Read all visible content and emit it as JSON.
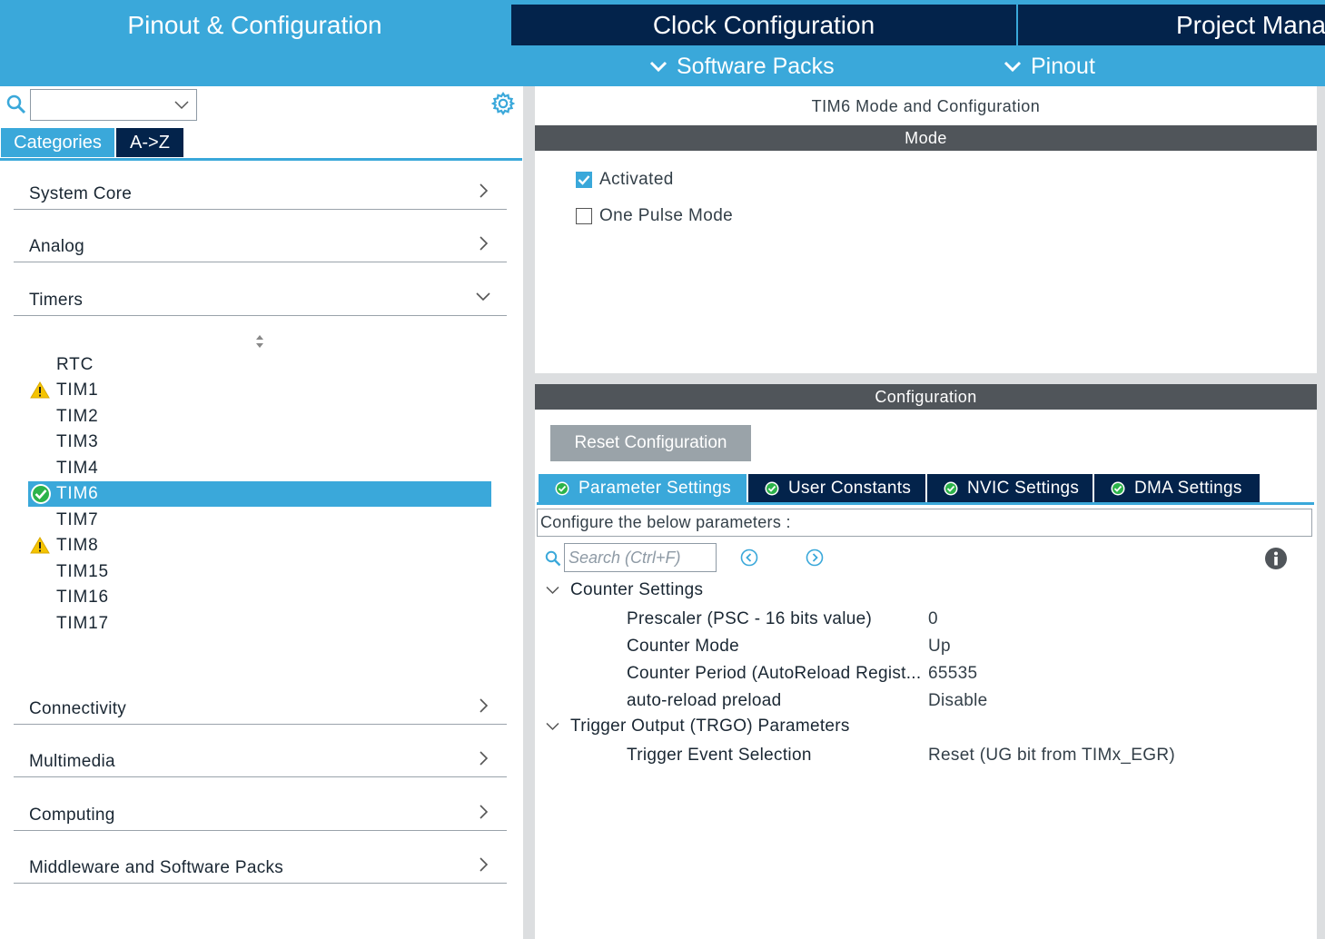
{
  "colors": {
    "accent": "#3aa8da",
    "navy": "#03234b",
    "bar": "#50555a",
    "warning": "#f5c400",
    "ok": "#2cb34a"
  },
  "top_tabs": {
    "pinout": "Pinout & Configuration",
    "clock": "Clock Configuration",
    "project": "Project Mana"
  },
  "sub_tabs": {
    "software_packs": "Software Packs",
    "pinout": "Pinout"
  },
  "left": {
    "combo_value": "",
    "tabs": {
      "categories": "Categories",
      "az": "A->Z"
    },
    "categories": [
      "System Core",
      "Analog",
      "Timers",
      "Connectivity",
      "Multimedia",
      "Computing",
      "Middleware and Software Packs"
    ],
    "timers": [
      {
        "name": "RTC",
        "status": "none"
      },
      {
        "name": "TIM1",
        "status": "warning"
      },
      {
        "name": "TIM2",
        "status": "none"
      },
      {
        "name": "TIM3",
        "status": "none"
      },
      {
        "name": "TIM4",
        "status": "none"
      },
      {
        "name": "TIM6",
        "status": "ok",
        "selected": true
      },
      {
        "name": "TIM7",
        "status": "none"
      },
      {
        "name": "TIM8",
        "status": "warning"
      },
      {
        "name": "TIM15",
        "status": "none"
      },
      {
        "name": "TIM16",
        "status": "none"
      },
      {
        "name": "TIM17",
        "status": "none"
      }
    ]
  },
  "right": {
    "title": "TIM6 Mode and Configuration",
    "mode_label": "Mode",
    "mode_options": [
      {
        "label": "Activated",
        "checked": true
      },
      {
        "label": "One Pulse Mode",
        "checked": false
      }
    ],
    "config_label": "Configuration",
    "reset_button": "Reset Configuration",
    "param_tabs": [
      "Parameter Settings",
      "User Constants",
      "NVIC Settings",
      "DMA Settings"
    ],
    "description": "Configure the below parameters :",
    "search_placeholder": "Search (Ctrl+F)",
    "groups": [
      {
        "name": "Counter Settings",
        "params": [
          {
            "name": "Prescaler (PSC - 16 bits value)",
            "value": "0"
          },
          {
            "name": "Counter Mode",
            "value": "Up"
          },
          {
            "name": "Counter Period (AutoReload Regist...",
            "value": "65535"
          },
          {
            "name": "auto-reload preload",
            "value": "Disable"
          }
        ]
      },
      {
        "name": "Trigger Output (TRGO) Parameters",
        "params": [
          {
            "name": "Trigger Event Selection",
            "value": "Reset (UG bit from TIMx_EGR)"
          }
        ]
      }
    ]
  }
}
